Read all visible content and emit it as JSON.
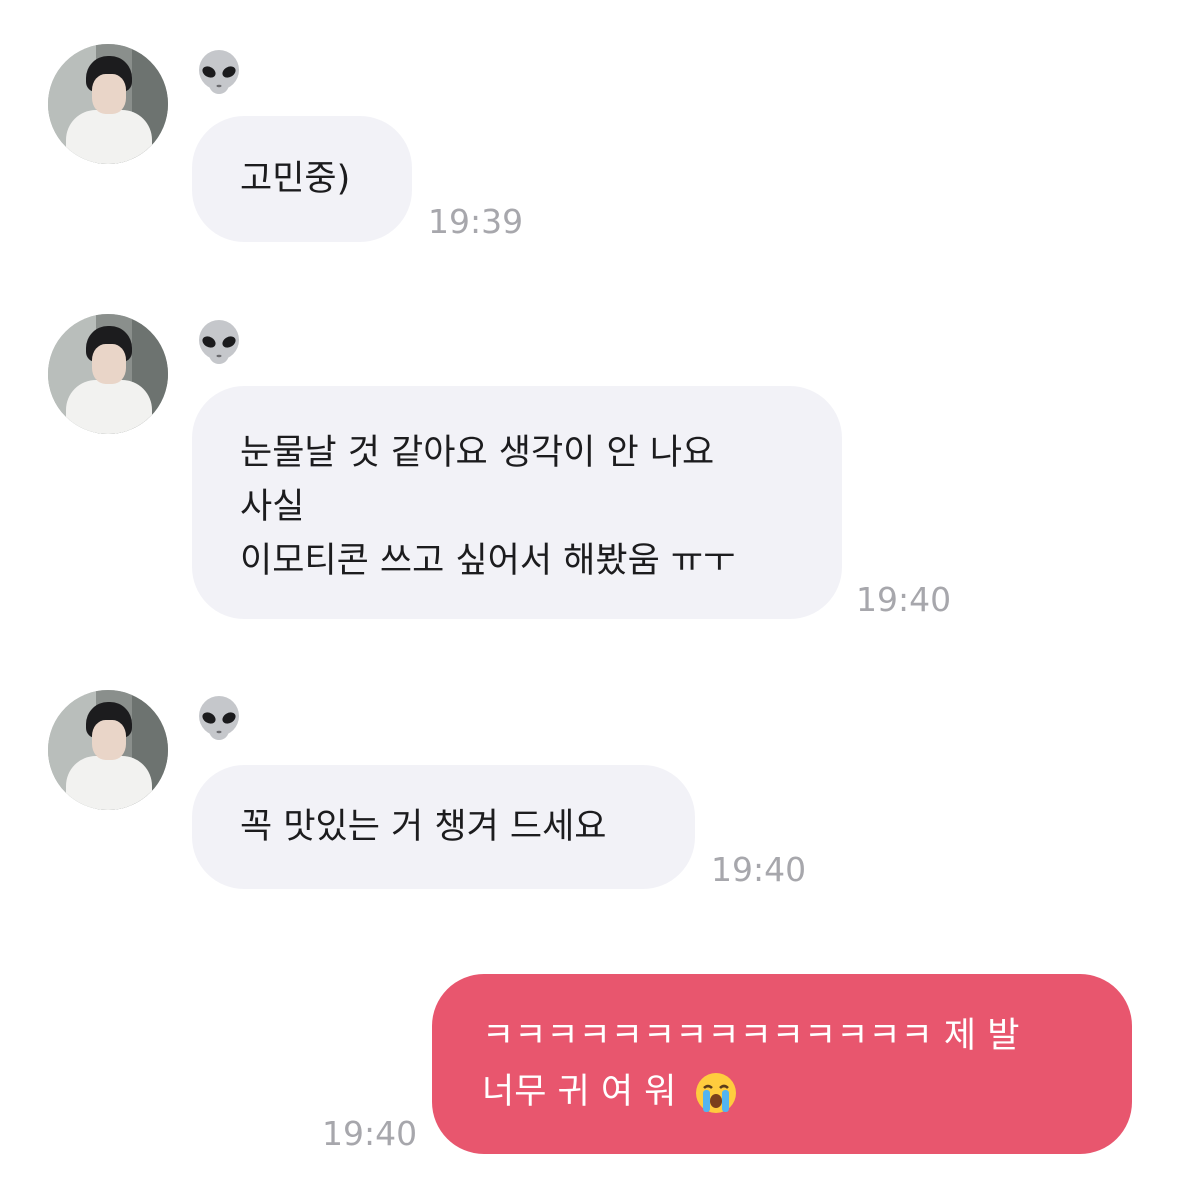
{
  "messages": [
    {
      "sender_icon": "alien-emoji",
      "lines": [
        "고민중)"
      ],
      "time": "19:39"
    },
    {
      "sender_icon": "alien-emoji",
      "lines": [
        "눈물날 것 같아요 생각이 안 나요",
        "사실",
        "이모티콘 쓰고 싶어서 해봤움 ㅠㅜ"
      ],
      "time": "19:40"
    },
    {
      "sender_icon": "alien-emoji",
      "lines": [
        "꼭 맛있는 거 챙겨 드세요"
      ],
      "time": "19:40"
    }
  ],
  "reply": {
    "lines": [
      "ㅋㅋㅋㅋㅋㅋㅋㅋㅋㅋㅋㅋㅋㅋ 제 발",
      "너무 귀 여 워"
    ],
    "emoji": "loudly-crying-face",
    "time": "19:40"
  },
  "colors": {
    "incoming_bubble": "#f2f2f7",
    "outgoing_bubble": "#e8566e",
    "timestamp": "#a7a7ac"
  }
}
